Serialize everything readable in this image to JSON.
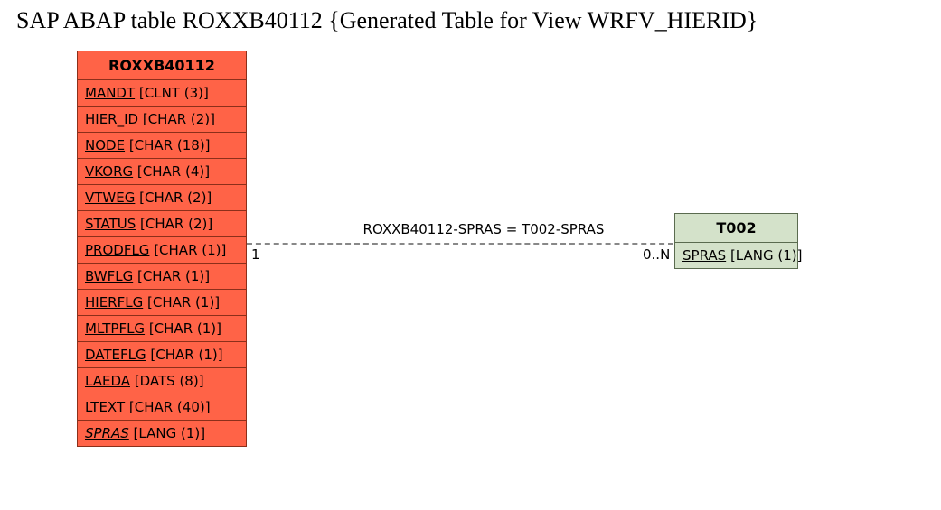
{
  "title": "SAP ABAP table ROXXB40112 {Generated Table for View WRFV_HIERID}",
  "left_entity": {
    "name": "ROXXB40112",
    "fields": [
      {
        "name": "MANDT",
        "type": "[CLNT (3)]",
        "italic": false
      },
      {
        "name": "HIER_ID",
        "type": "[CHAR (2)]",
        "italic": false
      },
      {
        "name": "NODE",
        "type": "[CHAR (18)]",
        "italic": false
      },
      {
        "name": "VKORG",
        "type": "[CHAR (4)]",
        "italic": false
      },
      {
        "name": "VTWEG",
        "type": "[CHAR (2)]",
        "italic": false
      },
      {
        "name": "STATUS",
        "type": "[CHAR (2)]",
        "italic": false
      },
      {
        "name": "PRODFLG",
        "type": "[CHAR (1)]",
        "italic": false
      },
      {
        "name": "BWFLG",
        "type": "[CHAR (1)]",
        "italic": false
      },
      {
        "name": "HIERFLG",
        "type": "[CHAR (1)]",
        "italic": false
      },
      {
        "name": "MLTPFLG",
        "type": "[CHAR (1)]",
        "italic": false
      },
      {
        "name": "DATEFLG",
        "type": "[CHAR (1)]",
        "italic": false
      },
      {
        "name": "LAEDA",
        "type": "[DATS (8)]",
        "italic": false
      },
      {
        "name": "LTEXT",
        "type": "[CHAR (40)]",
        "italic": false
      },
      {
        "name": "SPRAS",
        "type": "[LANG (1)]",
        "italic": true
      }
    ]
  },
  "right_entity": {
    "name": "T002",
    "fields": [
      {
        "name": "SPRAS",
        "type": "[LANG (1)]",
        "italic": false
      }
    ]
  },
  "relation": {
    "label": "ROXXB40112-SPRAS = T002-SPRAS",
    "card_left": "1",
    "card_right": "0..N"
  }
}
